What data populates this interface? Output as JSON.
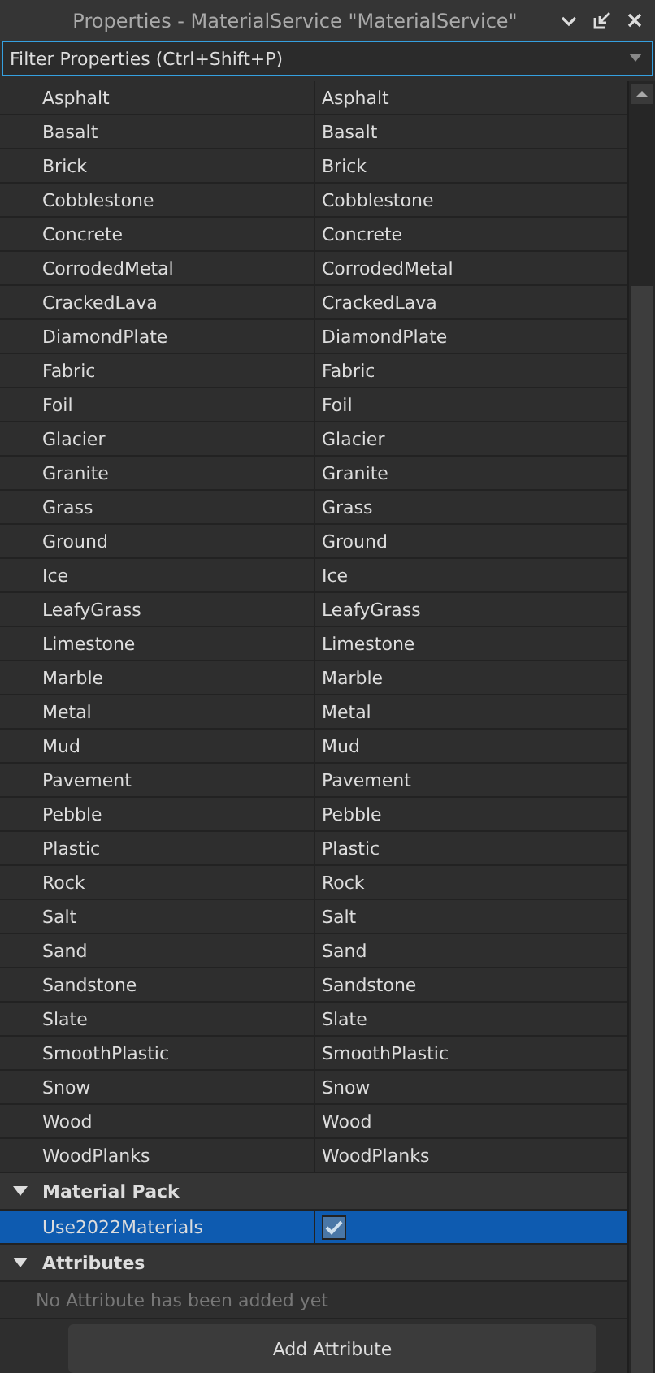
{
  "window": {
    "title": "Properties - MaterialService \"MaterialService\""
  },
  "filter": {
    "placeholder": "Filter Properties (Ctrl+Shift+P)"
  },
  "rows": [
    {
      "name": "Asphalt",
      "value": "Asphalt"
    },
    {
      "name": "Basalt",
      "value": "Basalt"
    },
    {
      "name": "Brick",
      "value": "Brick"
    },
    {
      "name": "Cobblestone",
      "value": "Cobblestone"
    },
    {
      "name": "Concrete",
      "value": "Concrete"
    },
    {
      "name": "CorrodedMetal",
      "value": "CorrodedMetal"
    },
    {
      "name": "CrackedLava",
      "value": "CrackedLava"
    },
    {
      "name": "DiamondPlate",
      "value": "DiamondPlate"
    },
    {
      "name": "Fabric",
      "value": "Fabric"
    },
    {
      "name": "Foil",
      "value": "Foil"
    },
    {
      "name": "Glacier",
      "value": "Glacier"
    },
    {
      "name": "Granite",
      "value": "Granite"
    },
    {
      "name": "Grass",
      "value": "Grass"
    },
    {
      "name": "Ground",
      "value": "Ground"
    },
    {
      "name": "Ice",
      "value": "Ice"
    },
    {
      "name": "LeafyGrass",
      "value": "LeafyGrass"
    },
    {
      "name": "Limestone",
      "value": "Limestone"
    },
    {
      "name": "Marble",
      "value": "Marble"
    },
    {
      "name": "Metal",
      "value": "Metal"
    },
    {
      "name": "Mud",
      "value": "Mud"
    },
    {
      "name": "Pavement",
      "value": "Pavement"
    },
    {
      "name": "Pebble",
      "value": "Pebble"
    },
    {
      "name": "Plastic",
      "value": "Plastic"
    },
    {
      "name": "Rock",
      "value": "Rock"
    },
    {
      "name": "Salt",
      "value": "Salt"
    },
    {
      "name": "Sand",
      "value": "Sand"
    },
    {
      "name": "Sandstone",
      "value": "Sandstone"
    },
    {
      "name": "Slate",
      "value": "Slate"
    },
    {
      "name": "SmoothPlastic",
      "value": "SmoothPlastic"
    },
    {
      "name": "Snow",
      "value": "Snow"
    },
    {
      "name": "Wood",
      "value": "Wood"
    },
    {
      "name": "WoodPlanks",
      "value": "WoodPlanks"
    }
  ],
  "material_pack": {
    "title": "Material Pack",
    "expanded": true,
    "rows": [
      {
        "name": "Use2022Materials",
        "checked": true,
        "selected": true
      }
    ]
  },
  "attributes": {
    "title": "Attributes",
    "expanded": true,
    "note": "No Attribute has been added yet",
    "button": "Add Attribute"
  }
}
